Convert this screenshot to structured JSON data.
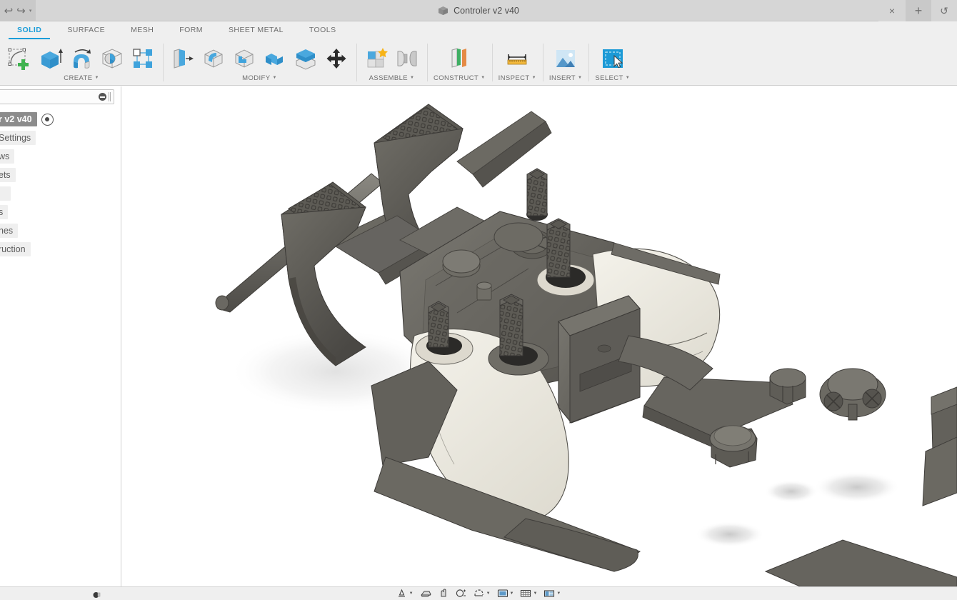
{
  "window": {
    "title": "Controler v2 v40",
    "doc_icon": "cube-icon",
    "quick_access": [
      {
        "name": "undo-button",
        "glyph": "↩"
      },
      {
        "name": "redo-button",
        "glyph": "↪"
      },
      {
        "name": "redo-dropdown-caret",
        "glyph": "▾"
      }
    ],
    "controls": [
      {
        "name": "close-tab-button",
        "glyph": "×",
        "kind": "close"
      },
      {
        "name": "new-tab-button",
        "glyph": "+",
        "kind": "plus"
      },
      {
        "name": "refresh-button",
        "glyph": "↺",
        "kind": "refresh"
      }
    ]
  },
  "tabs": [
    {
      "label": "SOLID",
      "name": "tab-solid",
      "active": true
    },
    {
      "label": "SURFACE",
      "name": "tab-surface",
      "active": false
    },
    {
      "label": "MESH",
      "name": "tab-mesh",
      "active": false
    },
    {
      "label": "FORM",
      "name": "tab-form",
      "active": false
    },
    {
      "label": "SHEET METAL",
      "name": "tab-sheet-metal",
      "active": false
    },
    {
      "label": "TOOLS",
      "name": "tab-tools",
      "active": false
    }
  ],
  "ribbon": {
    "groups": [
      {
        "label": "CREATE",
        "name": "ribbon-group-create",
        "has_caret": true,
        "icons": [
          {
            "name": "new-sketch-icon",
            "kind": "sketch-plus"
          },
          {
            "name": "extrude-icon",
            "kind": "extrude"
          },
          {
            "name": "revolve-icon",
            "kind": "revolve"
          },
          {
            "name": "hole-icon",
            "kind": "hole"
          },
          {
            "name": "pattern-icon",
            "kind": "pattern"
          }
        ]
      },
      {
        "label": "MODIFY",
        "name": "ribbon-group-modify",
        "has_caret": true,
        "icons": [
          {
            "name": "press-pull-icon",
            "kind": "presspull"
          },
          {
            "name": "fillet-icon",
            "kind": "fillet"
          },
          {
            "name": "shell-icon",
            "kind": "shell"
          },
          {
            "name": "combine-icon",
            "kind": "combine"
          },
          {
            "name": "offset-face-icon",
            "kind": "offsetface"
          },
          {
            "name": "move-copy-icon",
            "kind": "move"
          }
        ]
      },
      {
        "label": "ASSEMBLE",
        "name": "ribbon-group-assemble",
        "has_caret": true,
        "icons": [
          {
            "name": "new-component-icon",
            "kind": "newcomponent"
          },
          {
            "name": "joint-icon",
            "kind": "joint"
          }
        ]
      },
      {
        "label": "CONSTRUCT",
        "name": "ribbon-group-construct",
        "has_caret": true,
        "icons": [
          {
            "name": "offset-plane-icon",
            "kind": "offsetplane"
          }
        ]
      },
      {
        "label": "INSPECT",
        "name": "ribbon-group-inspect",
        "has_caret": true,
        "icons": [
          {
            "name": "measure-icon",
            "kind": "measure"
          }
        ]
      },
      {
        "label": "INSERT",
        "name": "ribbon-group-insert",
        "has_caret": true,
        "icons": [
          {
            "name": "insert-image-icon",
            "kind": "image"
          }
        ]
      },
      {
        "label": "SELECT",
        "name": "ribbon-group-select",
        "has_caret": true,
        "icons": [
          {
            "name": "select-window-icon",
            "kind": "select"
          }
        ]
      }
    ]
  },
  "browser": {
    "search_placeholder": "",
    "search_value": "",
    "clear_icon": "no-entry-icon",
    "items": [
      {
        "label": "r v2 v40",
        "name": "browser-item-document-root",
        "selected": true,
        "eye": true
      },
      {
        "label": "Settings",
        "name": "browser-item-document-settings",
        "selected": false,
        "eye": false
      },
      {
        "label": "ws",
        "name": "browser-item-named-views",
        "selected": false,
        "eye": false
      },
      {
        "label": "ets",
        "name": "browser-item-sheets",
        "selected": false,
        "eye": false
      },
      {
        "label": "",
        "name": "browser-item-origin",
        "selected": false,
        "eye": false
      },
      {
        "label": "s",
        "name": "browser-item-bodies",
        "selected": false,
        "eye": false
      },
      {
        "label": "hes",
        "name": "browser-item-sketches",
        "selected": false,
        "eye": false
      },
      {
        "label": "ruction",
        "name": "browser-item-construction",
        "selected": false,
        "eye": false
      }
    ]
  },
  "navbar": {
    "items": [
      {
        "name": "orbit-icon",
        "kind": "orbit",
        "caret": true
      },
      {
        "name": "look-at-icon",
        "kind": "lookat",
        "caret": false
      },
      {
        "name": "pan-icon",
        "kind": "pan",
        "caret": false
      },
      {
        "name": "zoom-icon",
        "kind": "zoom",
        "caret": false
      },
      {
        "name": "fit-icon",
        "kind": "fit",
        "caret": true
      },
      {
        "name": "display-settings-icon",
        "kind": "display",
        "caret": true
      },
      {
        "name": "grid-snaps-icon",
        "kind": "grid",
        "caret": true
      },
      {
        "name": "viewport-layout-icon",
        "kind": "viewports",
        "caret": true
      }
    ]
  },
  "colors": {
    "accent": "#1b9dd9",
    "ribbon_bg": "#efefef",
    "titlebar_bg": "#d6d6d6",
    "canvas_bg": "#ffffff",
    "model_dark": "#595751",
    "model_light": "#e8e6dd",
    "icon_blue": "#2f9fd8",
    "icon_gray": "#d3d3d3"
  },
  "viewport": {
    "model_name": "Controler v2 v40",
    "shading": "shaded-with-visible-edges"
  }
}
